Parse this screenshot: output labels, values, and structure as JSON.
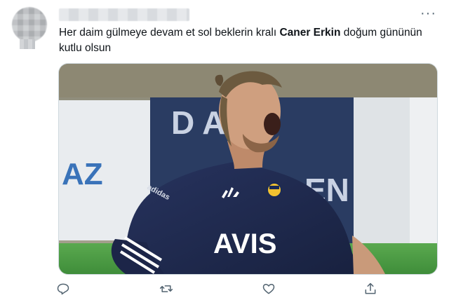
{
  "tweet": {
    "text_before": "Her daim gülmeye devam et sol beklerin kralı ",
    "text_bold": "Caner Erkin",
    "text_after": " doğum gününün kutlu olsun"
  },
  "more_menu": {
    "glyph": "···"
  },
  "media": {
    "board_text_left": "AZ",
    "board_text_top": "D   AT",
    "board_text_mid": "EN",
    "jersey_text": "AVIS",
    "sleeve_text": "adidas"
  },
  "actions": {
    "reply_icon": "reply-icon",
    "retweet_icon": "retweet-icon",
    "like_icon": "heart-icon",
    "share_icon": "share-icon"
  },
  "colors": {
    "text": "#0f1419",
    "secondary": "#536471",
    "border": "#cfd9de"
  }
}
